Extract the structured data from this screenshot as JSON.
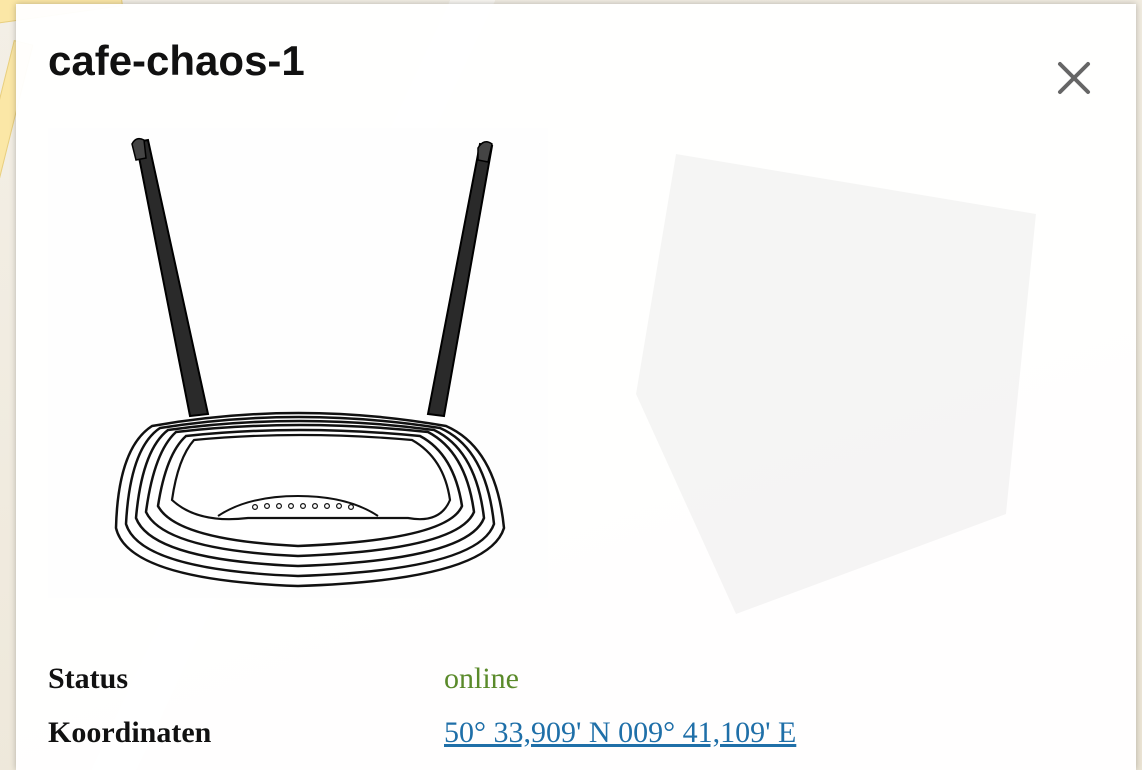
{
  "popup": {
    "title": "cafe-chaos-1",
    "close_icon": "close-icon",
    "image_icon": "wifi-router-icon"
  },
  "details": {
    "status_label": "Status",
    "status_value": "online",
    "status_color": "#5a8a2a",
    "coordinates_label": "Koordinaten",
    "coordinates_value": "50° 33,909' N 009° 41,109' E",
    "link_color": "#1f6fa8"
  }
}
